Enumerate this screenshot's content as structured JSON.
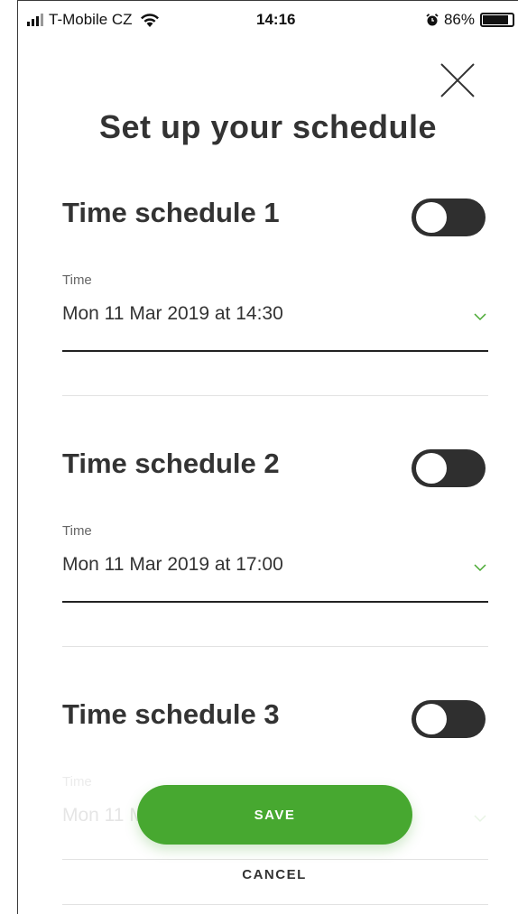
{
  "status_bar": {
    "carrier": "T-Mobile CZ",
    "time": "14:16",
    "battery": "86%",
    "battery_level": 0.86
  },
  "title": "Set up your schedule",
  "schedules": [
    {
      "title": "Time schedule 1",
      "time_label": "Time",
      "time_value": "Mon 11 Mar 2019 at 14:30",
      "enabled": false
    },
    {
      "title": "Time schedule 2",
      "time_label": "Time",
      "time_value": "Mon 11 Mar 2019 at 17:00",
      "enabled": false
    },
    {
      "title": "Time schedule 3",
      "time_label": "Time",
      "time_value": "Mon 11 Mar 2019 at 17:00",
      "enabled": false
    }
  ],
  "actions": {
    "save_label": "SAVE",
    "cancel_label": "CANCEL"
  },
  "colors": {
    "accent": "#47a830",
    "toggle_off": "#2f2f2f",
    "text": "#333333"
  },
  "icons": [
    "close-icon",
    "chevron-down-icon",
    "wifi-icon",
    "alarm-icon",
    "battery-icon",
    "signal-icon"
  ]
}
